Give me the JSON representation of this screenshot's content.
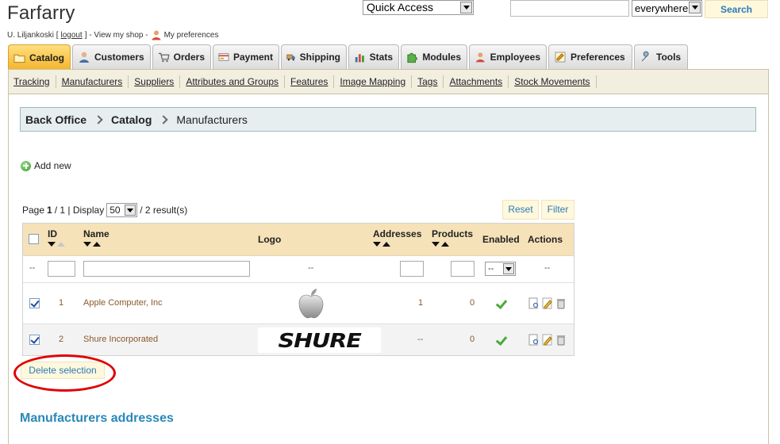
{
  "header": {
    "shop_name": "Farfarry",
    "user_prefix": "U. Liljankoski [",
    "logout": "logout",
    "view_shop": "] - View my shop -",
    "my_prefs": "My preferences"
  },
  "quick_access": {
    "value": "Quick Access"
  },
  "search": {
    "value": "",
    "scope": "everywhere",
    "button": "Search"
  },
  "tabs": [
    {
      "label": "Catalog",
      "icon": "folder-icon",
      "active": true
    },
    {
      "label": "Customers",
      "icon": "customer-icon"
    },
    {
      "label": "Orders",
      "icon": "cart-icon"
    },
    {
      "label": "Payment",
      "icon": "payment-icon"
    },
    {
      "label": "Shipping",
      "icon": "truck-icon"
    },
    {
      "label": "Stats",
      "icon": "bar-chart-icon"
    },
    {
      "label": "Modules",
      "icon": "puzzle-icon"
    },
    {
      "label": "Employees",
      "icon": "employee-icon"
    },
    {
      "label": "Preferences",
      "icon": "preferences-icon"
    },
    {
      "label": "Tools",
      "icon": "wrench-icon"
    }
  ],
  "subnav": [
    "Tracking",
    "Manufacturers",
    "Suppliers",
    "Attributes and Groups",
    "Features",
    "Image Mapping",
    "Tags",
    "Attachments",
    "Stock Movements"
  ],
  "breadcrumb": {
    "root": "Back Office",
    "section": "Catalog",
    "current": "Manufacturers"
  },
  "add_new": "Add new",
  "pager": {
    "page_label": "Page",
    "page_current": "1",
    "page_sep": " / 1 | Display",
    "display": "50",
    "results": "/ 2 result(s)"
  },
  "buttons": {
    "reset": "Reset",
    "filter": "Filter",
    "delete_selection": "Delete selection"
  },
  "table": {
    "headers": {
      "id": "ID",
      "name": "Name",
      "logo": "Logo",
      "addresses": "Addresses",
      "products": "Products",
      "enabled": "Enabled",
      "actions": "Actions"
    },
    "filter_row": {
      "dash": "--",
      "logo": "--",
      "enabled_select": "--",
      "actions": "--"
    },
    "rows": [
      {
        "checked": true,
        "id": "1",
        "name": "Apple Computer, Inc",
        "logo": "apple-logo",
        "addresses": "1",
        "products": "0",
        "enabled": true
      },
      {
        "checked": true,
        "id": "2",
        "name": "Shure Incorporated",
        "logo": "shure-logo",
        "logo_text": "SHURE",
        "addresses": "--",
        "products": "0",
        "enabled": true
      }
    ]
  },
  "section_title": "Manufacturers addresses",
  "colors": {
    "accent_blue": "#2a88b8",
    "tab_active": "#f5b52a",
    "highlight_red": "#e00000"
  }
}
